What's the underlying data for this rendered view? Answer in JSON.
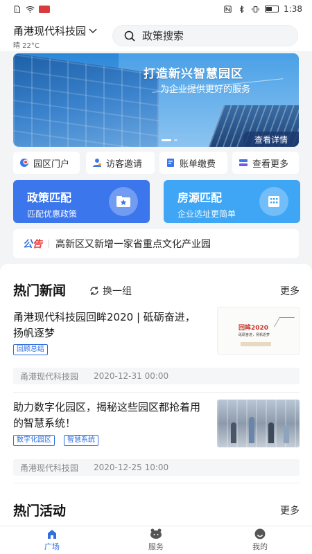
{
  "status_bar": {
    "time": "1:38"
  },
  "header": {
    "location": "甬港现代科技园",
    "weather": "晴 22°C",
    "search_placeholder": "政策搜索"
  },
  "banner": {
    "title": "打造新兴智慧园区",
    "subtitle": "为企业提供更好的服务",
    "button": "查看详情"
  },
  "quick_links": [
    {
      "label": "园区门户",
      "icon": "portal-icon"
    },
    {
      "label": "访客邀请",
      "icon": "visitor-icon"
    },
    {
      "label": "账单缴费",
      "icon": "bill-icon"
    },
    {
      "label": "查看更多",
      "icon": "more-icon"
    }
  ],
  "match_cards": [
    {
      "title": "政策匹配",
      "subtitle": "匹配优惠政策",
      "color": "#3b76ec",
      "icon": "folder-star-icon"
    },
    {
      "title": "房源匹配",
      "subtitle": "企业选址更简单",
      "color": "#3ea6f5",
      "icon": "building-icon"
    }
  ],
  "notice": {
    "tag_part1": "公",
    "tag_part2": "告",
    "text": "高新区又新增一家省重点文化产业园"
  },
  "hot_news": {
    "title": "热门新闻",
    "refresh": "换一组",
    "more": "更多",
    "items": [
      {
        "title": "甬港现代科技园回眸2020 | 砥砺奋进，扬帆逐梦",
        "tags": [
          "回顾总结"
        ],
        "source": "甬港现代科技园",
        "date": "2020-12-31 00:00",
        "thumb_title": "回眸2020",
        "thumb_line": "砥砺奋进，扬帆逐梦"
      },
      {
        "title": "助力数字化园区，揭秘这些园区都抢着用的智慧系统！",
        "tags": [
          "数字化园区",
          "智慧系统"
        ],
        "source": "甬港现代科技园",
        "date": "2020-12-25 10:00"
      }
    ]
  },
  "hot_events": {
    "title": "热门活动",
    "more": "更多"
  },
  "bottom_nav": [
    {
      "label": "广场",
      "active": true
    },
    {
      "label": "服务",
      "active": false
    },
    {
      "label": "我的",
      "active": false
    }
  ],
  "colors": {
    "primary": "#2f6fe0",
    "accent_red": "#ea3a3a"
  }
}
